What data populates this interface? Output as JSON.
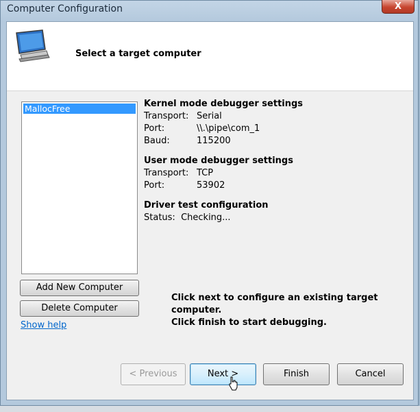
{
  "window": {
    "title": "Computer Configuration",
    "close_label": "X"
  },
  "header": {
    "title": "Select a target computer",
    "icon": "monitor-icon"
  },
  "computer_list": {
    "items": [
      {
        "label": "MallocFree",
        "selected": true
      }
    ]
  },
  "buttons": {
    "add_computer": "Add New Computer",
    "delete_computer": "Delete Computer",
    "show_help": "Show help",
    "previous": "< Previous",
    "next": "Next >",
    "finish": "Finish",
    "cancel": "Cancel"
  },
  "kernel": {
    "title": "Kernel mode debugger settings",
    "transport_label": "Transport:",
    "transport_value": "Serial",
    "port_label": "Port:",
    "port_value": "\\\\.\\pipe\\com_1",
    "baud_label": "Baud:",
    "baud_value": "115200"
  },
  "user": {
    "title": "User mode debugger settings",
    "transport_label": "Transport:",
    "transport_value": "TCP",
    "port_label": "Port:",
    "port_value": "53902"
  },
  "driver": {
    "title": "Driver test configuration",
    "status_label": "Status:",
    "status_value": "Checking..."
  },
  "info": {
    "line1": "Click next to configure an existing target computer.",
    "line2": "Click finish to start debugging."
  },
  "colors": {
    "selection": "#3399ff",
    "link": "#0066cc",
    "close": "#c7452f"
  }
}
